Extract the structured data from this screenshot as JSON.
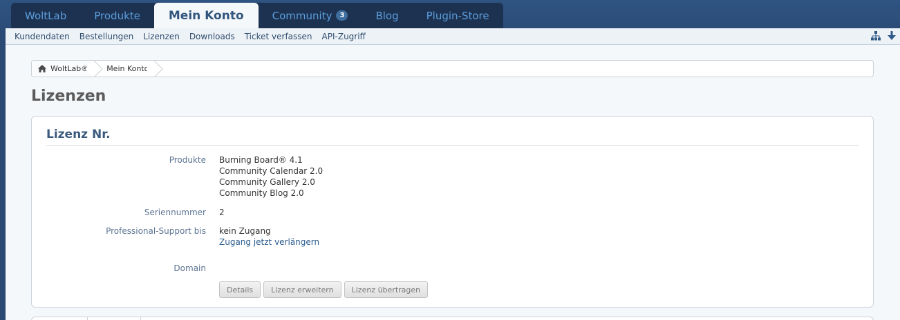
{
  "main_nav": {
    "tabs": [
      {
        "label": "WoltLab"
      },
      {
        "label": "Produkte"
      },
      {
        "label": "Mein Konto",
        "active": true
      },
      {
        "label": "Community",
        "badge": "3"
      },
      {
        "label": "Blog"
      },
      {
        "label": "Plugin-Store"
      }
    ]
  },
  "sub_nav": {
    "items": [
      "Kundendaten",
      "Bestellungen",
      "Lizenzen",
      "Downloads",
      "Ticket verfassen",
      "API-Zugriff"
    ],
    "icons": [
      "sitemap-icon",
      "arrow-down-icon"
    ]
  },
  "breadcrumb": {
    "items": [
      "WoltLab®",
      "Mein Konto"
    ]
  },
  "page": {
    "title": "Lizenzen"
  },
  "license": {
    "title": "Lizenz Nr.",
    "produkte_label": "Produkte",
    "produkte": [
      "Burning Board® 4.1",
      "Community Calendar 2.0",
      "Community Gallery 2.0",
      "Community Blog 2.0"
    ],
    "seriennummer_label": "Seriennummer",
    "seriennummer": "2",
    "support_label": "Professional-Support bis",
    "support_status": "kein Zugang",
    "support_link": "Zugang jetzt verlängern",
    "domain_label": "Domain",
    "buttons": {
      "details": "Details",
      "extend": "Lizenz erweitern",
      "transfer": "Lizenz übertragen"
    }
  },
  "colors": {
    "header_bg": "#2f5482",
    "nav_bg": "#1d3250",
    "nav_text": "#5b9ddd",
    "active_tab_text": "#32557c",
    "page_bg": "#f5f8fb"
  }
}
